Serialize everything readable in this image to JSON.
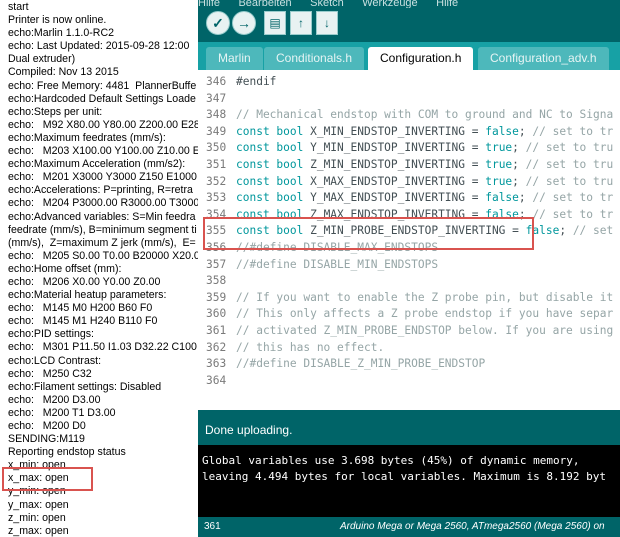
{
  "serial_monitor": {
    "lines": [
      "start",
      "Printer is now online.",
      "echo:Marlin 1.1.0-RC2",
      "echo: Last Updated: 2015-09-28 12:00",
      "Dual extruder)",
      "Compiled: Nov 13 2015",
      "echo: Free Memory: 4481  PlannerBuffe",
      "echo:Hardcoded Default Settings Loade",
      "echo:Steps per unit:",
      "echo:   M92 X80.00 Y80.00 Z200.00 E28",
      "echo:Maximum feedrates (mm/s):",
      "echo:   M203 X100.00 Y100.00 Z10.00 E",
      "echo:Maximum Acceleration (mm/s2):",
      "echo:   M201 X3000 Y3000 Z150 E1000",
      "echo:Accelerations: P=printing, R=retra",
      "echo:   M204 P3000.00 R3000.00 T3000",
      "echo:Advanced variables: S=Min feedra",
      "feedrate (mm/s), B=minimum segment ti",
      "(mm/s),  Z=maximum Z jerk (mm/s),  E=",
      "echo:   M205 S0.00 T0.00 B20000 X20.0",
      "echo:Home offset (mm):",
      "echo:   M206 X0.00 Y0.00 Z0.00",
      "echo:Material heatup parameters:",
      "echo:   M145 M0 H200 B60 F0",
      "echo:   M145 M1 H240 B110 F0",
      "echo:PID settings:",
      "echo:   M301 P11.50 I1.03 D32.22 C100",
      "echo:LCD Contrast:",
      "echo:   M250 C32",
      "echo:Filament settings: Disabled",
      "echo:   M200 D3.00",
      "echo:   M200 T1 D3.00",
      "echo:   M200 D0",
      "SENDING:M119",
      "Reporting endstop status",
      "x_min: open",
      "x_max: open",
      "y_min: open",
      "y_max: open",
      "z_min: open",
      "z_max: open"
    ]
  },
  "ide": {
    "menu": [
      "Hilfe",
      "Bearbeiten",
      "Sketch",
      "Werkzeuge",
      "Hilfe"
    ],
    "toolbar": {
      "verify_icon": "checkmark-icon",
      "upload_icon": "arrow-right-icon",
      "new_icon": "new-file-icon",
      "open_icon": "open-up-icon",
      "save_icon": "save-down-icon"
    },
    "tabs": [
      "Marlin",
      "Conditionals.h",
      "Configuration.h",
      "Configuration_adv.h"
    ],
    "active_tab": "Configuration.h",
    "code": [
      {
        "n": "346",
        "parts": [
          {
            "t": "#endif",
            "c": "dir"
          }
        ]
      },
      {
        "n": "347",
        "parts": []
      },
      {
        "n": "348",
        "parts": [
          {
            "t": "// Mechanical endstop with COM to ground and NC to Signa",
            "c": "cm"
          }
        ]
      },
      {
        "n": "349",
        "parts": [
          {
            "t": "const bool",
            "c": "kw"
          },
          {
            "t": " X_MIN_ENDSTOP_INVERTING = ",
            "c": ""
          },
          {
            "t": "false",
            "c": "kw"
          },
          {
            "t": "; ",
            "c": ""
          },
          {
            "t": "// set to tr",
            "c": "cm"
          }
        ]
      },
      {
        "n": "350",
        "parts": [
          {
            "t": "const bool",
            "c": "kw"
          },
          {
            "t": " Y_MIN_ENDSTOP_INVERTING = ",
            "c": ""
          },
          {
            "t": "true",
            "c": "kw"
          },
          {
            "t": "; ",
            "c": ""
          },
          {
            "t": "// set to tru",
            "c": "cm"
          }
        ]
      },
      {
        "n": "351",
        "parts": [
          {
            "t": "const bool",
            "c": "kw"
          },
          {
            "t": " Z_MIN_ENDSTOP_INVERTING = ",
            "c": ""
          },
          {
            "t": "true",
            "c": "kw"
          },
          {
            "t": "; ",
            "c": ""
          },
          {
            "t": "// set to tru",
            "c": "cm"
          }
        ]
      },
      {
        "n": "352",
        "parts": [
          {
            "t": "const bool",
            "c": "kw"
          },
          {
            "t": " X_MAX_ENDSTOP_INVERTING = ",
            "c": ""
          },
          {
            "t": "true",
            "c": "kw"
          },
          {
            "t": "; ",
            "c": ""
          },
          {
            "t": "// set to tru",
            "c": "cm"
          }
        ]
      },
      {
        "n": "353",
        "parts": [
          {
            "t": "const bool",
            "c": "kw"
          },
          {
            "t": " Y_MAX_ENDSTOP_INVERTING = ",
            "c": ""
          },
          {
            "t": "false",
            "c": "kw"
          },
          {
            "t": "; ",
            "c": ""
          },
          {
            "t": "// set to tr",
            "c": "cm"
          }
        ]
      },
      {
        "n": "354",
        "parts": [
          {
            "t": "const bool",
            "c": "kw"
          },
          {
            "t": " Z_MAX_ENDSTOP_INVERTING = ",
            "c": ""
          },
          {
            "t": "false",
            "c": "kw"
          },
          {
            "t": "; ",
            "c": ""
          },
          {
            "t": "// set to tr",
            "c": "cm"
          }
        ]
      },
      {
        "n": "355",
        "parts": [
          {
            "t": "const bool",
            "c": "kw"
          },
          {
            "t": " Z_MIN_PROBE_ENDSTOP_INVERTING = ",
            "c": ""
          },
          {
            "t": "false",
            "c": "kw"
          },
          {
            "t": "; ",
            "c": ""
          },
          {
            "t": "// set",
            "c": "cm"
          }
        ]
      },
      {
        "n": "356",
        "parts": [
          {
            "t": "//#define DISABLE_MAX_ENDSTOPS",
            "c": "cm"
          }
        ]
      },
      {
        "n": "357",
        "parts": [
          {
            "t": "//#define DISABLE_MIN_ENDSTOPS",
            "c": "cm"
          }
        ]
      },
      {
        "n": "358",
        "parts": []
      },
      {
        "n": "359",
        "parts": [
          {
            "t": "// If you want to enable the Z probe pin, but disable it",
            "c": "cm"
          }
        ]
      },
      {
        "n": "360",
        "parts": [
          {
            "t": "// This only affects a Z probe endstop if you have separ",
            "c": "cm"
          }
        ]
      },
      {
        "n": "361",
        "parts": [
          {
            "t": "// activated Z_MIN_PROBE_ENDSTOP below. If you are using",
            "c": "cm"
          }
        ]
      },
      {
        "n": "362",
        "parts": [
          {
            "t": "// this has no effect.",
            "c": "cm"
          }
        ]
      },
      {
        "n": "363",
        "parts": [
          {
            "t": "//#define DISABLE_Z_MIN_PROBE_ENDSTOP",
            "c": "cm"
          }
        ]
      },
      {
        "n": "364",
        "parts": []
      }
    ],
    "status": "Done uploading.",
    "console": [
      "Global variables use 3.698 bytes (45%) of dynamic memory,",
      "leaving 4.494 bytes for local variables. Maximum is 8.192 byt"
    ],
    "footer_line": "361",
    "footer_board": "Arduino Mega or Mega 2560, ATmega2560 (Mega 2560) on"
  },
  "colors": {
    "ide_teal": "#006468",
    "tab_bar": "#17a1a5",
    "keyword": "#00979c",
    "highlight_box": "#d9534f"
  }
}
